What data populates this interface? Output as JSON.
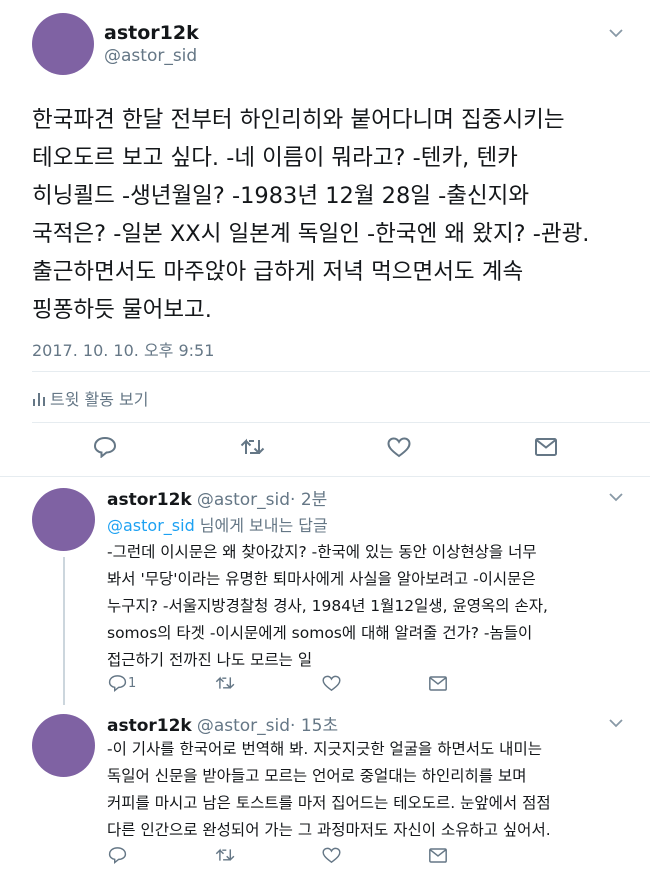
{
  "main_tweet": {
    "name": "astor12k",
    "handle": "@astor_sid",
    "text": "한국파견 한달 전부터 하인리히와 붙어다니며 집중시키는\n테오도르 보고 싶다. -네 이름이 뭐라고? -텐카, 텐카\n히닝쾰드 -생년월일? -1983년 12월 28일 -출신지와\n국적은? -일본 XX시 일본계 독일인 -한국엔 왜 왔지? -관광.\n출근하면서도 마주앉아 급하게 저녁 먹으면서도 계속\n핑퐁하듯 물어보고.",
    "timestamp": "2017. 10. 10. 오후 9:51",
    "activity_label": "트윗 활동 보기"
  },
  "replies": [
    {
      "name": "astor12k",
      "handle": "@astor_sid",
      "time": "· 2분",
      "reply_to_handle": "@astor_sid",
      "reply_to_suffix": " 님에게 보내는 답글",
      "text": "-그런데 이시문은 왜 찾아갔지? -한국에 있는 동안 이상현상을 너무\n봐서 '무당'이라는 유명한 퇴마사에게 사실을 알아보려고 -이시문은\n누구지? -서울지방경찰청 경사, 1984년 1월12일생, 윤영옥의 손자,\nsomos의 타겟 -이시문에게 somos에 대해 알려줄 건가? -놈들이\n접근하기 전까진 나도 모르는 일",
      "reply_count": "1"
    },
    {
      "name": "astor12k",
      "handle": "@astor_sid",
      "time": "· 15초",
      "text": "-이 기사를 한국어로 번역해 봐. 지긋지긋한 얼굴을 하면서도 내미는\n독일어 신문을 받아들고 모르는 언어로 중얼대는 하인리히를 보며\n커피를 마시고 남은 토스트를 마저 집어드는 테오도르. 눈앞에서 점점\n다른 인간으로 완성되어 가는 그 과정마저도 자신이 소유하고 싶어서."
    }
  ],
  "colors": {
    "avatar": "#7f62a3",
    "link": "#1da1f2",
    "muted": "#657786"
  },
  "icons": [
    "chevron-down-icon",
    "activity-chart-icon",
    "reply-icon",
    "retweet-icon",
    "like-icon",
    "message-icon"
  ]
}
